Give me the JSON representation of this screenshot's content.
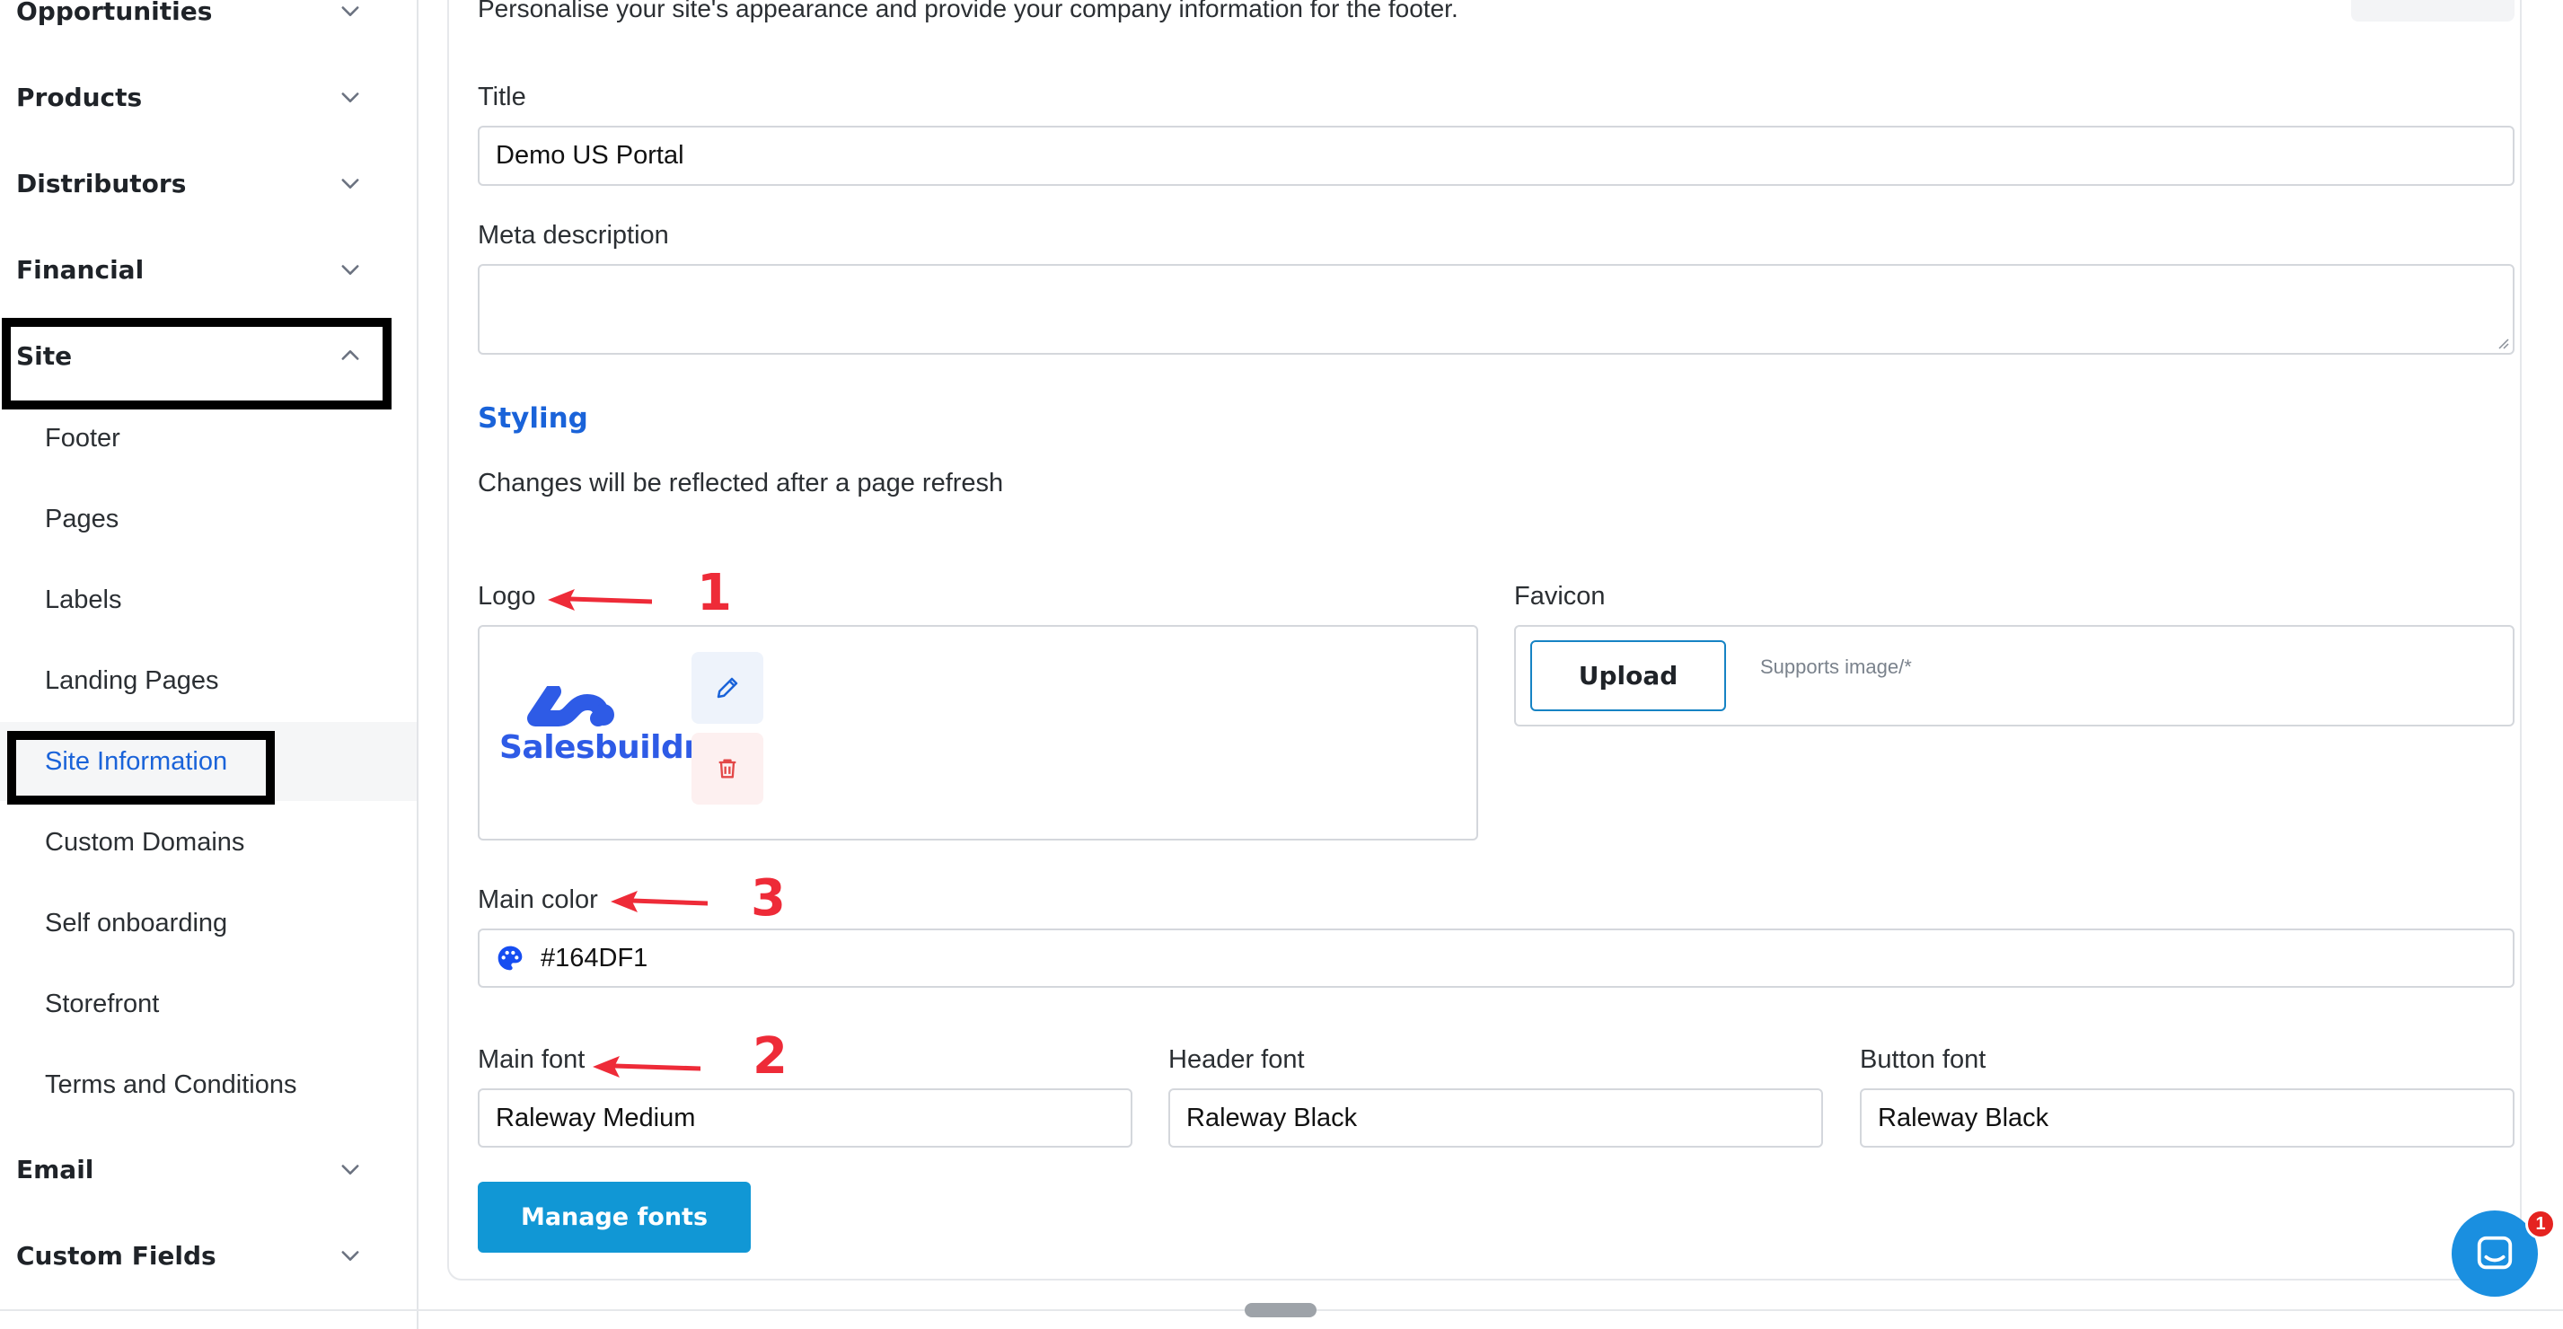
{
  "sidebar": {
    "groups": [
      {
        "label": "Opportunities",
        "expanded": false
      },
      {
        "label": "Products",
        "expanded": false
      },
      {
        "label": "Distributors",
        "expanded": false
      },
      {
        "label": "Financial",
        "expanded": false
      },
      {
        "label": "Site",
        "expanded": true
      },
      {
        "label": "Email",
        "expanded": false
      },
      {
        "label": "Custom Fields",
        "expanded": false
      }
    ],
    "site_items": [
      {
        "label": "Footer"
      },
      {
        "label": "Pages"
      },
      {
        "label": "Labels"
      },
      {
        "label": "Landing Pages"
      },
      {
        "label": "Site Information",
        "active": true
      },
      {
        "label": "Custom Domains"
      },
      {
        "label": "Self onboarding"
      },
      {
        "label": "Storefront"
      },
      {
        "label": "Terms and Conditions"
      }
    ]
  },
  "main": {
    "intro": "Personalise your site's appearance and provide your company information for the footer.",
    "title_label": "Title",
    "title_value": "Demo US Portal",
    "meta_label": "Meta description",
    "meta_value": "",
    "styling": {
      "heading": "Styling",
      "note": "Changes will be reflected after a page refresh"
    },
    "logo": {
      "label": "Logo",
      "brand_text": "Salesbuildr"
    },
    "favicon": {
      "label": "Favicon",
      "upload_label": "Upload",
      "supports": "Supports image/*"
    },
    "main_color": {
      "label": "Main color",
      "value": "#164DF1"
    },
    "fonts": {
      "main_label": "Main font",
      "main_value": "Raleway Medium",
      "header_label": "Header font",
      "header_value": "Raleway Black",
      "button_label": "Button font",
      "button_value": "Raleway Black"
    },
    "manage_fonts_label": "Manage fonts"
  },
  "annotations": {
    "logo": "1",
    "main_font": "2",
    "main_color": "3"
  },
  "chat": {
    "badge": "1"
  },
  "colors": {
    "accent": "#1A63D9",
    "brand_blue": "#164DF1",
    "button_blue": "#1197D5",
    "annotation_red": "#EE2B38",
    "delete_red": "#E34848"
  }
}
